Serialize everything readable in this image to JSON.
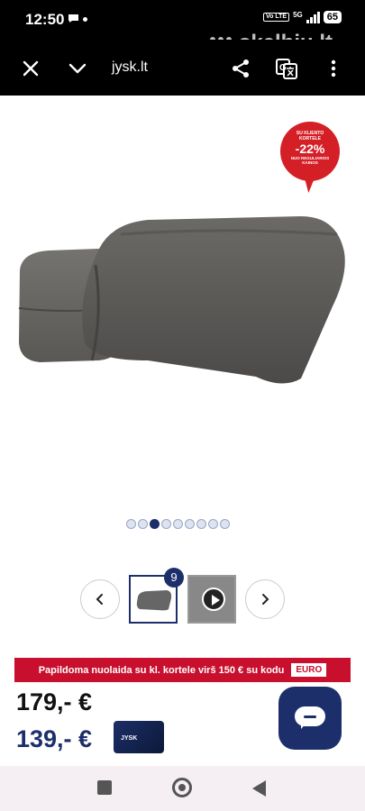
{
  "status": {
    "time": "12:50",
    "volte": "Vo LTE",
    "network": "5G",
    "battery": "65"
  },
  "watermark": {
    "text": "skelbiu.lt"
  },
  "toolbar": {
    "url": "jysk.lt",
    "close_icon": "close-icon",
    "collapse_icon": "chevron-down-icon",
    "share_icon": "share-icon",
    "translate_icon": "translate-icon",
    "menu_icon": "more-vertical-icon"
  },
  "badge": {
    "top": "SU KLIENTO KORTELE",
    "percent": "-22%",
    "bottom": "NUO REGULIARIOS KAINOS"
  },
  "gallery": {
    "dot_count": 9,
    "active_index": 2,
    "thumb_count": "9"
  },
  "promo": {
    "text": "Papildoma nuolaida su kl. kortele virš 150 € su kodu",
    "code": "EURO"
  },
  "prices": {
    "regular": "179,- €",
    "member": "139,- €",
    "card_label": "JYSK"
  },
  "colors": {
    "brand": "#1c2f6b",
    "promo_red": "#c8102e",
    "badge_red": "#d51f26"
  }
}
